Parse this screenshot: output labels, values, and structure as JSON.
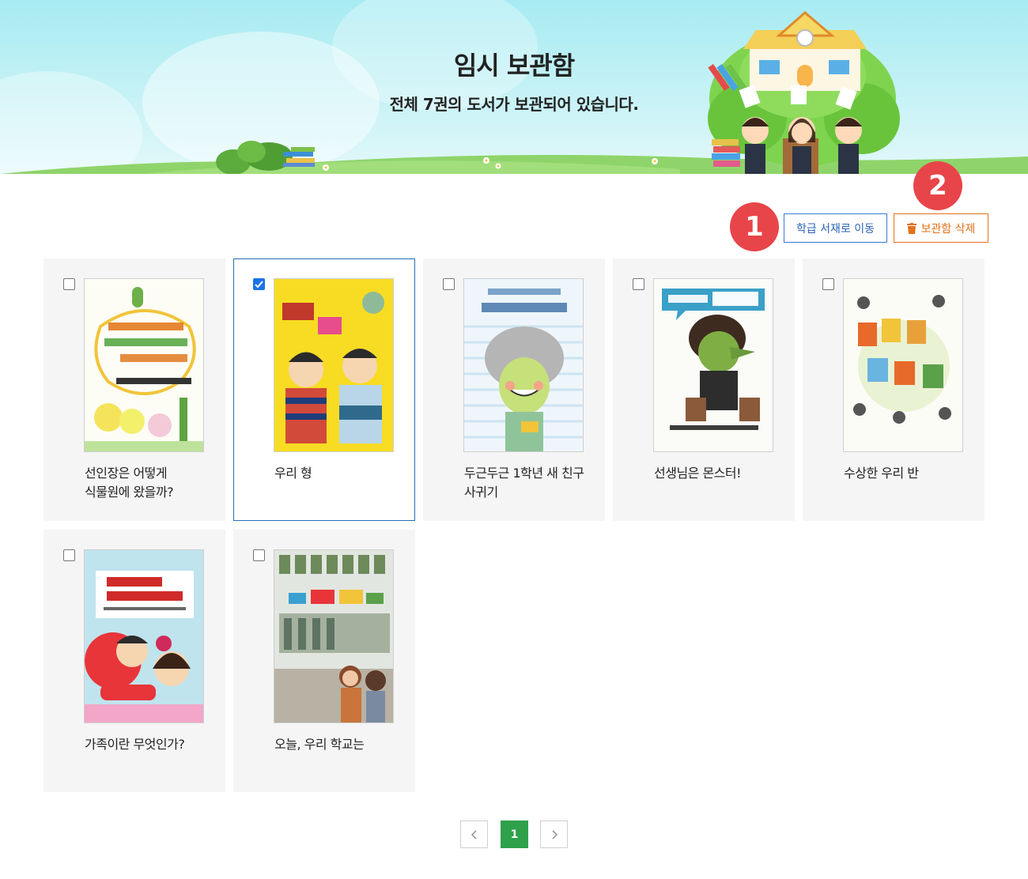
{
  "header": {
    "title": "임시 보관함",
    "subtitle": "전체 7권의 도서가 보관되어 있습니다."
  },
  "actions": {
    "move_label": "학급 서재로 이동",
    "delete_label": "보관함 삭제",
    "marker_1": "1",
    "marker_2": "2"
  },
  "books": [
    {
      "title": "선인장은 어떻게 식물원에 왔을까?",
      "checked": false
    },
    {
      "title": "우리 형",
      "checked": true
    },
    {
      "title": "두근두근 1학년 새 친구 사귀기",
      "checked": false
    },
    {
      "title": "선생님은 몬스터!",
      "checked": false
    },
    {
      "title": "수상한 우리 반",
      "checked": false
    },
    {
      "title": "가족이란 무엇인가?",
      "checked": false
    },
    {
      "title": "오늘, 우리 학교는",
      "checked": false
    }
  ],
  "pagination": {
    "prev_icon": "chevron-left-icon",
    "current": "1",
    "next_icon": "chevron-right-icon"
  },
  "colors": {
    "move_button": "#2a63b8",
    "delete_button": "#e4711b",
    "marker": "#e8454a",
    "current_page": "#2ea14a",
    "selected_border": "#2a6fb5"
  }
}
